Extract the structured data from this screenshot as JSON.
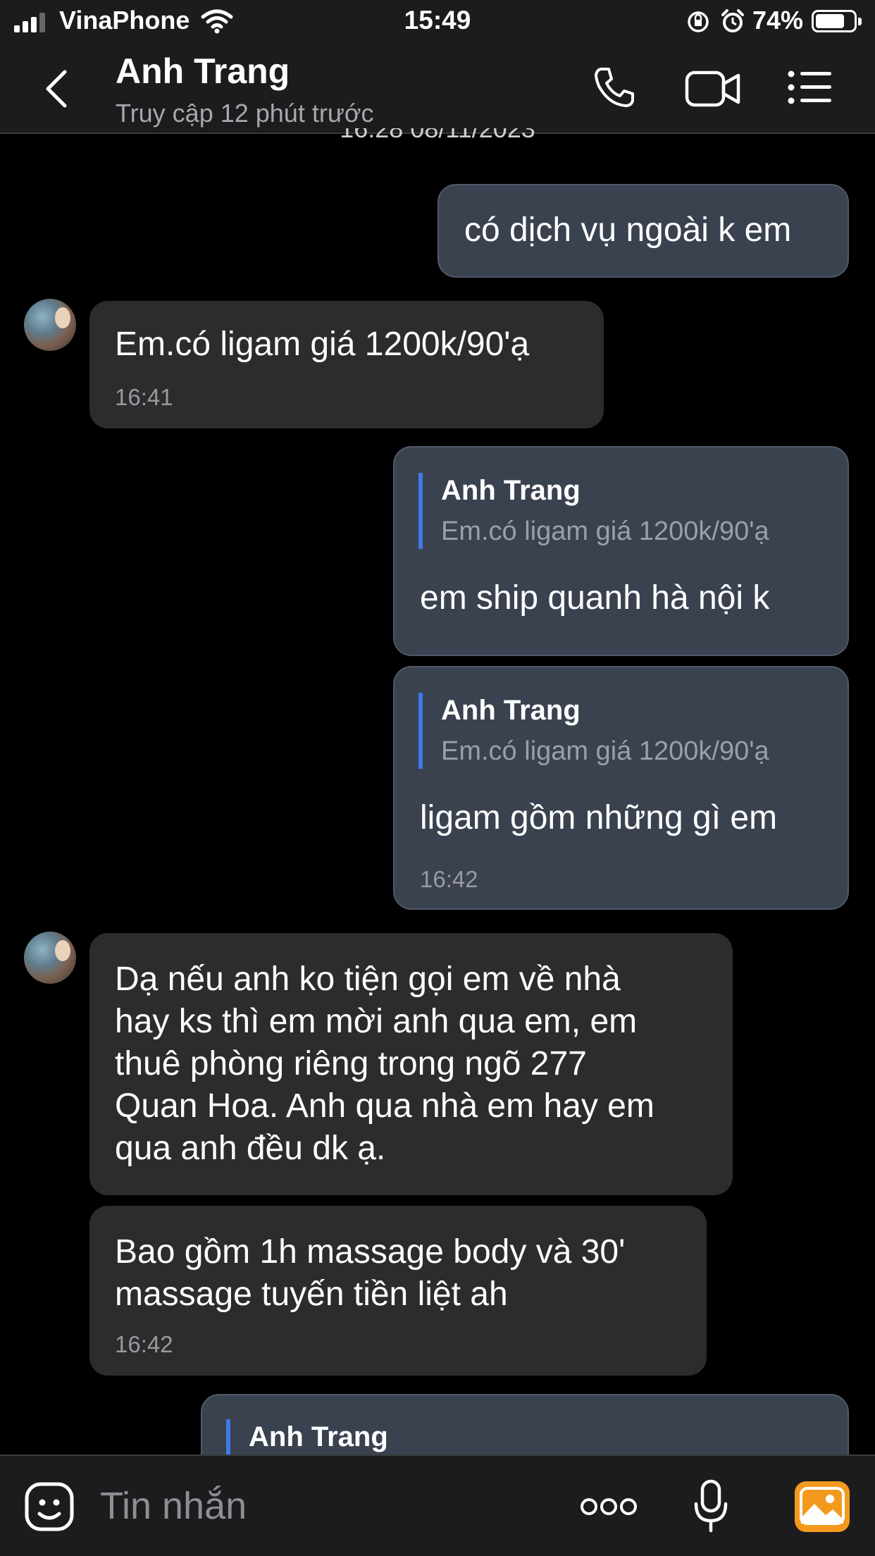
{
  "status": {
    "carrier": "VinaPhone",
    "time": "15:49",
    "battery": "74%"
  },
  "header": {
    "name": "Anh Trang",
    "status": "Truy cập 12 phút trước"
  },
  "date_separator": "16:28 08/11/2023",
  "messages": [
    {
      "text": "có dịch vụ ngoài k em"
    },
    {
      "text": "Em.có ligam giá 1200k/90'ạ",
      "time": "16:41"
    },
    {
      "quote_name": "Anh Trang",
      "quote_text": "Em.có ligam giá 1200k/90'ạ",
      "text": "em ship quanh hà nội k"
    },
    {
      "quote_name": "Anh Trang",
      "quote_text": "Em.có ligam giá 1200k/90'ạ",
      "text": "ligam gồm những gì em",
      "time": "16:42"
    },
    {
      "lines": [
        "Dạ nếu anh ko tiện gọi em về nhà",
        "hay ks thì em mời anh qua em, em",
        "thuê phòng riêng trong ngõ 277",
        "Quan Hoa. Anh qua nhà em hay em",
        "qua anh đều dk ạ."
      ]
    },
    {
      "lines": [
        "Bao gồm 1h massage body và 30'",
        "massage tuyến tiền liệt ah"
      ],
      "time": "16:42"
    },
    {
      "quote_name": "Anh Trang"
    }
  ],
  "composer": {
    "placeholder": "Tin nhắn"
  },
  "colors": {
    "accent": "#3f7ae6",
    "outgoing_bubble": "#3a4250",
    "incoming_bubble": "#2c2c2e",
    "image_button": "#f39a1e"
  }
}
